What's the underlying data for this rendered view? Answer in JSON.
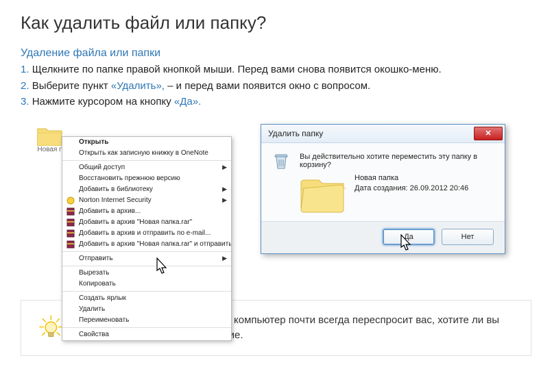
{
  "page_title": "Как удалить файл или папку?",
  "subtitle": "Удаление файла или папки",
  "steps": [
    {
      "n": "1.",
      "text_a": "Щелкните по папке правой кнопкой мыши. Перед вами снова появится окошко-меню.",
      "q": "",
      "text_b": ""
    },
    {
      "n": "2.",
      "text_a": "Выберите пункт ",
      "q": "«Удалить»,",
      "text_b": " – и перед вами появится окно с вопросом."
    },
    {
      "n": "3.",
      "text_a": "Нажмите курсором на кнопку ",
      "q": "«Да».",
      "text_b": ""
    }
  ],
  "folder_label": "Новая п",
  "context_menu": [
    {
      "label": "Открыть",
      "bold": true,
      "arrow": false,
      "ico": ""
    },
    {
      "label": "Открыть как записную книжку в OneNote",
      "ico": ""
    },
    {
      "sep": true
    },
    {
      "label": "Общий доступ",
      "arrow": true,
      "ico": ""
    },
    {
      "label": "Восстановить прежнюю версию",
      "ico": ""
    },
    {
      "label": "Добавить в библиотеку",
      "arrow": true,
      "ico": ""
    },
    {
      "label": "Norton Internet Security",
      "arrow": true,
      "ico": "ni"
    },
    {
      "label": "Добавить в архив...",
      "ico": "rar"
    },
    {
      "label": "Добавить в архив \"Новая папка.rar\"",
      "ico": "rar"
    },
    {
      "label": "Добавить в архив и отправить по e-mail...",
      "ico": "rar"
    },
    {
      "label": "Добавить в архив \"Новая папка.rar\" и отправить по e-mail",
      "ico": "rar"
    },
    {
      "sep": true
    },
    {
      "label": "Отправить",
      "arrow": true,
      "ico": ""
    },
    {
      "sep": true
    },
    {
      "label": "Вырезать",
      "ico": ""
    },
    {
      "label": "Копировать",
      "ico": ""
    },
    {
      "sep": true
    },
    {
      "label": "Создать ярлык",
      "ico": ""
    },
    {
      "label": "Удалить",
      "ico": ""
    },
    {
      "label": "Переименовать",
      "ico": ""
    },
    {
      "sep": true
    },
    {
      "label": "Свойства",
      "ico": ""
    }
  ],
  "dialog": {
    "title": "Удалить папку",
    "question": "Вы действительно хотите переместить эту папку в корзину?",
    "folder_name": "Новая папка",
    "folder_date": "Дата создания: 26.09.2012 20:46",
    "btn_yes": "Да",
    "btn_no": "Нет"
  },
  "tip": "Чтобы избежать случайностей, компьютер почти всегда переспросит вас, хотите ли вы совершить то или иное действие."
}
